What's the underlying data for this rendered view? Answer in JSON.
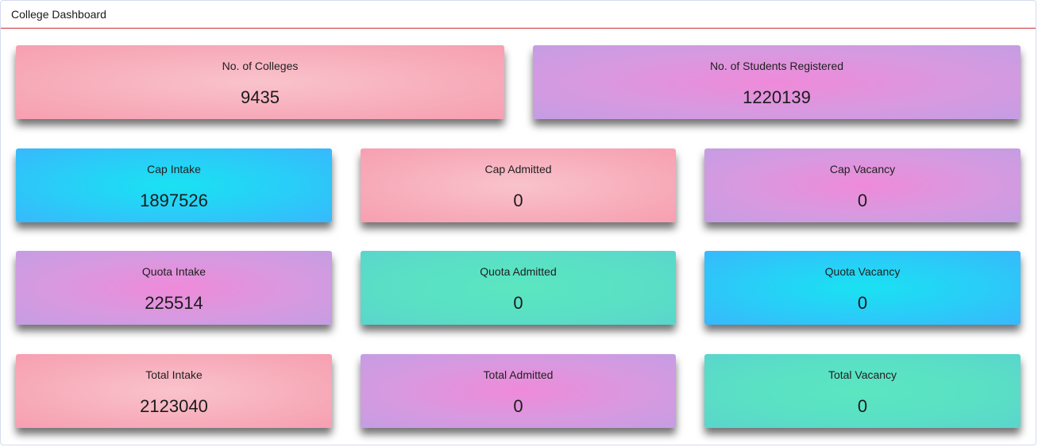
{
  "header": {
    "title": "College Dashboard"
  },
  "cards": [
    {
      "label": "No. of Colleges",
      "value": "9435"
    },
    {
      "label": "No. of Students Registered",
      "value": "1220139"
    },
    {
      "label": "Cap Intake",
      "value": "1897526"
    },
    {
      "label": "Cap Admitted",
      "value": "0"
    },
    {
      "label": "Cap Vacancy",
      "value": "0"
    },
    {
      "label": "Quota Intake",
      "value": "225514"
    },
    {
      "label": "Quota Admitted",
      "value": "0"
    },
    {
      "label": "Quota Vacancy",
      "value": "0"
    },
    {
      "label": "Total Intake",
      "value": "2123040"
    },
    {
      "label": "Total Admitted",
      "value": "0"
    },
    {
      "label": "Total Vacancy",
      "value": "0"
    }
  ]
}
